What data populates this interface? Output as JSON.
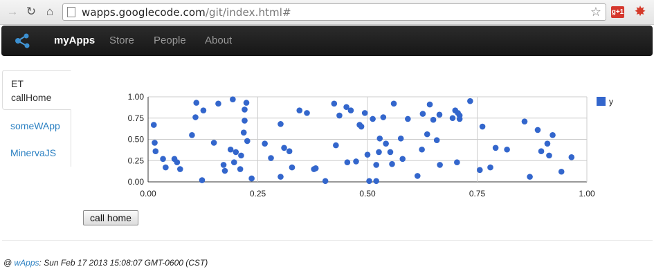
{
  "browser": {
    "url_host": "wapps.googlecode.com",
    "url_path": "/git/index.html#"
  },
  "navbar": {
    "brand": "myApps",
    "links": [
      "Store",
      "People",
      "About"
    ]
  },
  "tabs": {
    "active_line1": "ET",
    "active_line2": "callHome",
    "items": [
      "someWApp",
      "MinervaJS"
    ]
  },
  "chart_data": {
    "type": "scatter",
    "xlim": [
      0,
      1
    ],
    "ylim": [
      0,
      1
    ],
    "x_ticks": [
      "0.00",
      "0.25",
      "0.50",
      "0.75",
      "1.00"
    ],
    "y_ticks": [
      "0.00",
      "0.25",
      "0.50",
      "0.75",
      "1.00"
    ],
    "grid": true,
    "legend": "right",
    "series": [
      {
        "name": "y",
        "color": "#3366cc",
        "points": [
          [
            0.013,
            0.67
          ],
          [
            0.015,
            0.46
          ],
          [
            0.017,
            0.36
          ],
          [
            0.034,
            0.27
          ],
          [
            0.04,
            0.17
          ],
          [
            0.06,
            0.27
          ],
          [
            0.066,
            0.23
          ],
          [
            0.073,
            0.15
          ],
          [
            0.1,
            0.55
          ],
          [
            0.11,
            0.93
          ],
          [
            0.108,
            0.76
          ],
          [
            0.123,
            0.02
          ],
          [
            0.126,
            0.84
          ],
          [
            0.15,
            0.46
          ],
          [
            0.16,
            0.92
          ],
          [
            0.172,
            0.2
          ],
          [
            0.175,
            0.13
          ],
          [
            0.188,
            0.38
          ],
          [
            0.193,
            0.97
          ],
          [
            0.196,
            0.23
          ],
          [
            0.2,
            0.35
          ],
          [
            0.21,
            0.15
          ],
          [
            0.212,
            0.31
          ],
          [
            0.218,
            0.58
          ],
          [
            0.22,
            0.72
          ],
          [
            0.22,
            0.85
          ],
          [
            0.224,
            0.93
          ],
          [
            0.226,
            0.48
          ],
          [
            0.236,
            0.04
          ],
          [
            0.266,
            0.45
          ],
          [
            0.28,
            0.28
          ],
          [
            0.302,
            0.06
          ],
          [
            0.302,
            0.68
          ],
          [
            0.31,
            0.4
          ],
          [
            0.322,
            0.36
          ],
          [
            0.328,
            0.17
          ],
          [
            0.345,
            0.84
          ],
          [
            0.362,
            0.81
          ],
          [
            0.378,
            0.15
          ],
          [
            0.382,
            0.16
          ],
          [
            0.404,
            0.01
          ],
          [
            0.424,
            0.92
          ],
          [
            0.428,
            0.43
          ],
          [
            0.436,
            0.78
          ],
          [
            0.452,
            0.88
          ],
          [
            0.454,
            0.23
          ],
          [
            0.462,
            0.84
          ],
          [
            0.474,
            0.24
          ],
          [
            0.482,
            0.67
          ],
          [
            0.486,
            0.65
          ],
          [
            0.494,
            0.81
          ],
          [
            0.5,
            0.32
          ],
          [
            0.504,
            0.01
          ],
          [
            0.512,
            0.74
          ],
          [
            0.52,
            0.01
          ],
          [
            0.52,
            0.2
          ],
          [
            0.526,
            0.35
          ],
          [
            0.528,
            0.51
          ],
          [
            0.536,
            0.76
          ],
          [
            0.542,
            0.45
          ],
          [
            0.552,
            0.35
          ],
          [
            0.556,
            0.21
          ],
          [
            0.56,
            0.92
          ],
          [
            0.576,
            0.51
          ],
          [
            0.58,
            0.27
          ],
          [
            0.592,
            0.74
          ],
          [
            0.614,
            0.07
          ],
          [
            0.624,
            0.38
          ],
          [
            0.626,
            0.8
          ],
          [
            0.636,
            0.56
          ],
          [
            0.642,
            0.91
          ],
          [
            0.65,
            0.73
          ],
          [
            0.658,
            0.49
          ],
          [
            0.664,
            0.79
          ],
          [
            0.665,
            0.2
          ],
          [
            0.694,
            0.75
          ],
          [
            0.7,
            0.84
          ],
          [
            0.704,
            0.23
          ],
          [
            0.706,
            0.81
          ],
          [
            0.71,
            0.74
          ],
          [
            0.71,
            0.78
          ],
          [
            0.734,
            0.95
          ],
          [
            0.756,
            0.14
          ],
          [
            0.762,
            0.65
          ],
          [
            0.78,
            0.17
          ],
          [
            0.792,
            0.4
          ],
          [
            0.818,
            0.38
          ],
          [
            0.858,
            0.71
          ],
          [
            0.87,
            0.06
          ],
          [
            0.888,
            0.61
          ],
          [
            0.896,
            0.36
          ],
          [
            0.91,
            0.45
          ],
          [
            0.914,
            0.31
          ],
          [
            0.922,
            0.55
          ],
          [
            0.942,
            0.12
          ],
          [
            0.965,
            0.29
          ]
        ]
      }
    ]
  },
  "button": {
    "label": "call home"
  },
  "footer": {
    "prefix": "@ ",
    "link": "wApps",
    "text": ": Sun Feb 17 2013 15:08:07 GMT-0600 (CST)"
  }
}
